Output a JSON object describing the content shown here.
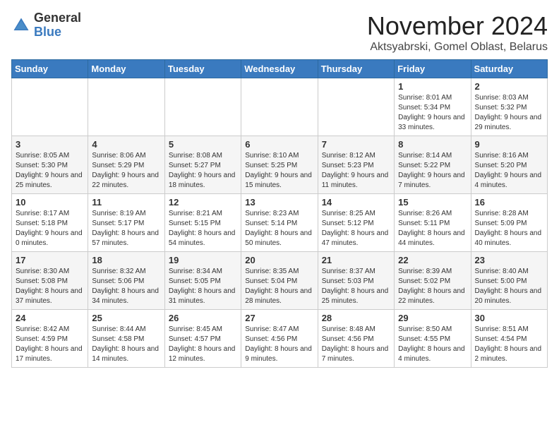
{
  "header": {
    "logo_general": "General",
    "logo_blue": "Blue",
    "title": "November 2024",
    "location": "Aktsyabrski, Gomel Oblast, Belarus"
  },
  "columns": [
    "Sunday",
    "Monday",
    "Tuesday",
    "Wednesday",
    "Thursday",
    "Friday",
    "Saturday"
  ],
  "weeks": [
    [
      {
        "day": "",
        "info": ""
      },
      {
        "day": "",
        "info": ""
      },
      {
        "day": "",
        "info": ""
      },
      {
        "day": "",
        "info": ""
      },
      {
        "day": "",
        "info": ""
      },
      {
        "day": "1",
        "info": "Sunrise: 8:01 AM\nSunset: 5:34 PM\nDaylight: 9 hours and 33 minutes."
      },
      {
        "day": "2",
        "info": "Sunrise: 8:03 AM\nSunset: 5:32 PM\nDaylight: 9 hours and 29 minutes."
      }
    ],
    [
      {
        "day": "3",
        "info": "Sunrise: 8:05 AM\nSunset: 5:30 PM\nDaylight: 9 hours and 25 minutes."
      },
      {
        "day": "4",
        "info": "Sunrise: 8:06 AM\nSunset: 5:29 PM\nDaylight: 9 hours and 22 minutes."
      },
      {
        "day": "5",
        "info": "Sunrise: 8:08 AM\nSunset: 5:27 PM\nDaylight: 9 hours and 18 minutes."
      },
      {
        "day": "6",
        "info": "Sunrise: 8:10 AM\nSunset: 5:25 PM\nDaylight: 9 hours and 15 minutes."
      },
      {
        "day": "7",
        "info": "Sunrise: 8:12 AM\nSunset: 5:23 PM\nDaylight: 9 hours and 11 minutes."
      },
      {
        "day": "8",
        "info": "Sunrise: 8:14 AM\nSunset: 5:22 PM\nDaylight: 9 hours and 7 minutes."
      },
      {
        "day": "9",
        "info": "Sunrise: 8:16 AM\nSunset: 5:20 PM\nDaylight: 9 hours and 4 minutes."
      }
    ],
    [
      {
        "day": "10",
        "info": "Sunrise: 8:17 AM\nSunset: 5:18 PM\nDaylight: 9 hours and 0 minutes."
      },
      {
        "day": "11",
        "info": "Sunrise: 8:19 AM\nSunset: 5:17 PM\nDaylight: 8 hours and 57 minutes."
      },
      {
        "day": "12",
        "info": "Sunrise: 8:21 AM\nSunset: 5:15 PM\nDaylight: 8 hours and 54 minutes."
      },
      {
        "day": "13",
        "info": "Sunrise: 8:23 AM\nSunset: 5:14 PM\nDaylight: 8 hours and 50 minutes."
      },
      {
        "day": "14",
        "info": "Sunrise: 8:25 AM\nSunset: 5:12 PM\nDaylight: 8 hours and 47 minutes."
      },
      {
        "day": "15",
        "info": "Sunrise: 8:26 AM\nSunset: 5:11 PM\nDaylight: 8 hours and 44 minutes."
      },
      {
        "day": "16",
        "info": "Sunrise: 8:28 AM\nSunset: 5:09 PM\nDaylight: 8 hours and 40 minutes."
      }
    ],
    [
      {
        "day": "17",
        "info": "Sunrise: 8:30 AM\nSunset: 5:08 PM\nDaylight: 8 hours and 37 minutes."
      },
      {
        "day": "18",
        "info": "Sunrise: 8:32 AM\nSunset: 5:06 PM\nDaylight: 8 hours and 34 minutes."
      },
      {
        "day": "19",
        "info": "Sunrise: 8:34 AM\nSunset: 5:05 PM\nDaylight: 8 hours and 31 minutes."
      },
      {
        "day": "20",
        "info": "Sunrise: 8:35 AM\nSunset: 5:04 PM\nDaylight: 8 hours and 28 minutes."
      },
      {
        "day": "21",
        "info": "Sunrise: 8:37 AM\nSunset: 5:03 PM\nDaylight: 8 hours and 25 minutes."
      },
      {
        "day": "22",
        "info": "Sunrise: 8:39 AM\nSunset: 5:02 PM\nDaylight: 8 hours and 22 minutes."
      },
      {
        "day": "23",
        "info": "Sunrise: 8:40 AM\nSunset: 5:00 PM\nDaylight: 8 hours and 20 minutes."
      }
    ],
    [
      {
        "day": "24",
        "info": "Sunrise: 8:42 AM\nSunset: 4:59 PM\nDaylight: 8 hours and 17 minutes."
      },
      {
        "day": "25",
        "info": "Sunrise: 8:44 AM\nSunset: 4:58 PM\nDaylight: 8 hours and 14 minutes."
      },
      {
        "day": "26",
        "info": "Sunrise: 8:45 AM\nSunset: 4:57 PM\nDaylight: 8 hours and 12 minutes."
      },
      {
        "day": "27",
        "info": "Sunrise: 8:47 AM\nSunset: 4:56 PM\nDaylight: 8 hours and 9 minutes."
      },
      {
        "day": "28",
        "info": "Sunrise: 8:48 AM\nSunset: 4:56 PM\nDaylight: 8 hours and 7 minutes."
      },
      {
        "day": "29",
        "info": "Sunrise: 8:50 AM\nSunset: 4:55 PM\nDaylight: 8 hours and 4 minutes."
      },
      {
        "day": "30",
        "info": "Sunrise: 8:51 AM\nSunset: 4:54 PM\nDaylight: 8 hours and 2 minutes."
      }
    ]
  ]
}
